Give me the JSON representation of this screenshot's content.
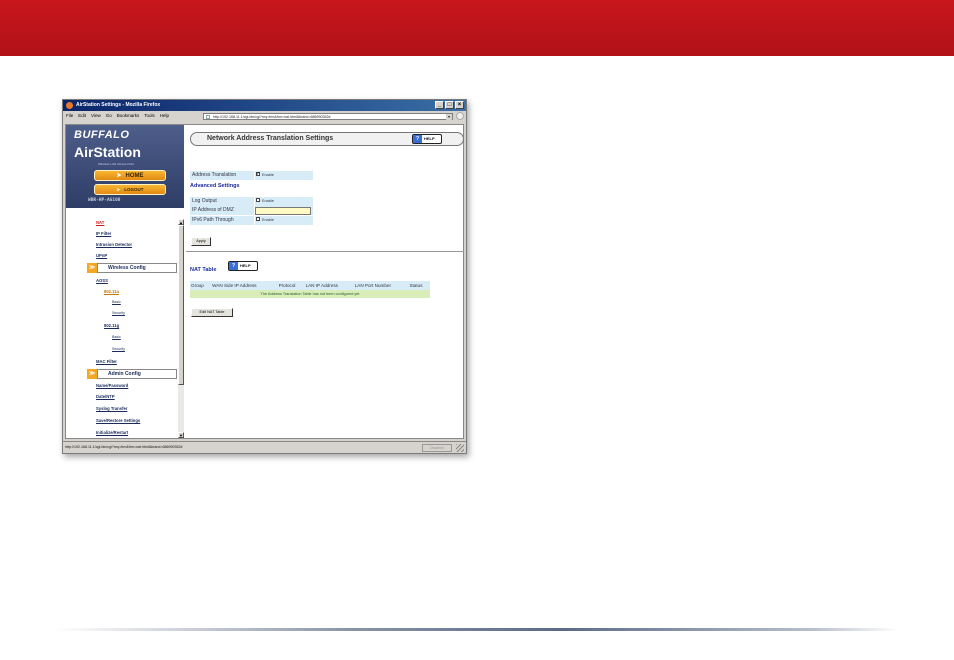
{
  "window": {
    "title": "AirStation Settings - Mozilla Firefox",
    "min": "_",
    "max": "□",
    "close": "×"
  },
  "menu": [
    "File",
    "Edit",
    "View",
    "Go",
    "Bookmarks",
    "Tools",
    "Help"
  ],
  "url": "http://192.168.11.1/cgi-bin/cgi?req=frm&frm=nat.html&brand=686990352#",
  "url_drop": "▾",
  "sidebar": {
    "brand": "BUFFALO",
    "product": "AirStation",
    "product_sub": "Wireless LAN Access Point",
    "home": "HOME",
    "logout": "LOGOUT",
    "arrow": "➤",
    "model": "WBR-HP-AG108",
    "links": {
      "nat": "NAT",
      "ip_filter": "IP Filter",
      "intrusion": "Intrusion Detector",
      "upnp": "UPnP",
      "aoss": "AOSS",
      "w80211a": "802.11a",
      "a_basic": "Basic",
      "a_security": "Security",
      "w80211g": "802.11g",
      "g_basic": "Basic",
      "g_security": "Security",
      "mac_filter": "MAC Filter",
      "name_password": "Name/Password",
      "date_ntp": "Date/NTP",
      "syslog": "Syslog Transfer",
      "save_restore": "Save/Restore Settings",
      "init_restart": "Initialize/Restart"
    },
    "sections": {
      "wireless": "Wireless Config",
      "admin": "Admin Config",
      "badge": "≫"
    }
  },
  "main": {
    "header": "Network Address Translation Settings",
    "help": "HELP",
    "help_q": "?",
    "address_translation_label": "Address Translation",
    "enable": "Enable",
    "advanced_settings": "Advanced Settings",
    "log_output_label": "Log Output",
    "dmz_label": "IP Address of DMZ",
    "ipv6_label": "IPv6 Path Through",
    "apply": "Apply",
    "nat_table_title": "NAT Table",
    "table_headers": [
      "Group",
      "WAN Side IP Address",
      "Protocol",
      "LAN IP Address",
      "LAN Port Number",
      "Status"
    ],
    "table_empty": "The Address Translation Table has not been configured yet",
    "edit_nat": "Edit NAT Table"
  },
  "status": {
    "url": "http://192.168.11.1/cgi-bin/cgi?req=frm&frm=nat.html&brand=686990352#",
    "disabled": "Disabled"
  }
}
